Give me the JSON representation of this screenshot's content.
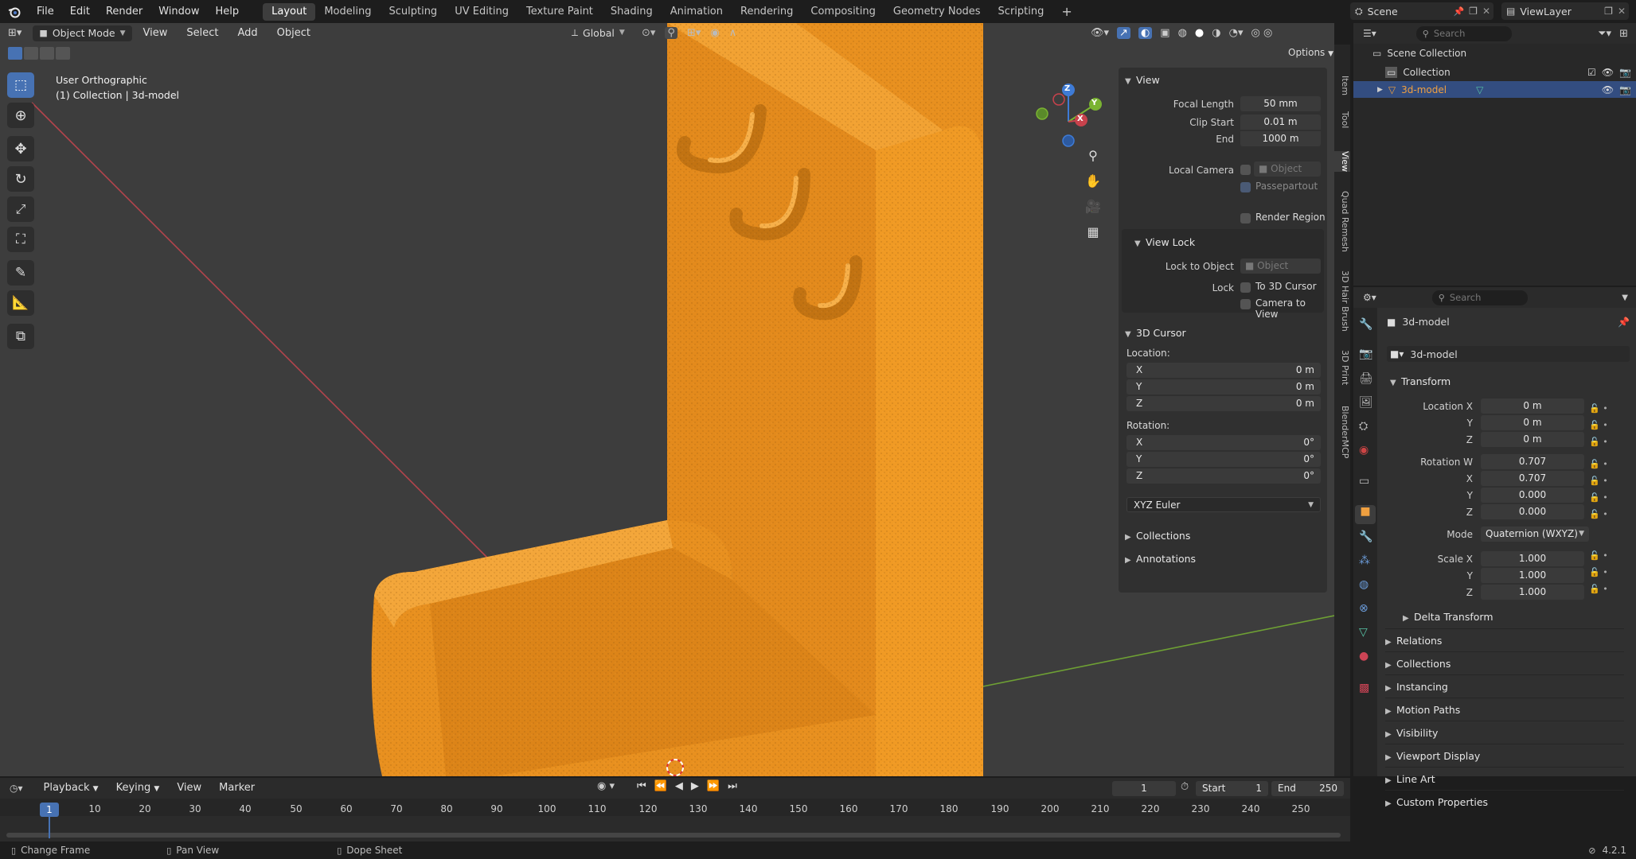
{
  "menu": {
    "items": [
      "File",
      "Edit",
      "Render",
      "Window",
      "Help"
    ]
  },
  "workspaces": {
    "tabs": [
      "Layout",
      "Modeling",
      "Sculpting",
      "UV Editing",
      "Texture Paint",
      "Shading",
      "Animation",
      "Rendering",
      "Compositing",
      "Geometry Nodes",
      "Scripting"
    ],
    "active": "Layout",
    "add": "+"
  },
  "scene": {
    "name": "Scene",
    "view_layer": "ViewLayer"
  },
  "viewport_header": {
    "mode": "Object Mode",
    "menus": [
      "View",
      "Select",
      "Add",
      "Object"
    ],
    "transform_orientation": "Global",
    "options": "Options"
  },
  "viewport": {
    "view_name": "User Orthographic",
    "context": "(1) Collection | 3d-model"
  },
  "gizmo": {
    "x": "X",
    "y": "Y",
    "z": "Z"
  },
  "sidebar_tabs": [
    "Item",
    "Tool",
    "View",
    "Quad Remesh",
    "3D Hair Brush",
    "3D Print",
    "BlenderMCP"
  ],
  "npanel": {
    "view": {
      "title": "View",
      "focal_length_label": "Focal Length",
      "focal_length": "50 mm",
      "clip_start_label": "Clip Start",
      "clip_start": "0.01 m",
      "clip_end_label": "End",
      "clip_end": "1000 m",
      "local_camera_label": "Local Camera",
      "object_placeholder": "Object",
      "passepartout": "Passepartout",
      "render_region": "Render Region"
    },
    "view_lock": {
      "title": "View Lock",
      "lock_to_object_label": "Lock to Object",
      "object_placeholder": "Object",
      "lock_label": "Lock",
      "to_3d_cursor": "To 3D Cursor",
      "camera_to_view": "Camera to View"
    },
    "cursor": {
      "title": "3D Cursor",
      "location_label": "Location:",
      "loc": [
        {
          "axis": "X",
          "value": "0 m"
        },
        {
          "axis": "Y",
          "value": "0 m"
        },
        {
          "axis": "Z",
          "value": "0 m"
        }
      ],
      "rotation_label": "Rotation:",
      "rot": [
        {
          "axis": "X",
          "value": "0°"
        },
        {
          "axis": "Y",
          "value": "0°"
        },
        {
          "axis": "Z",
          "value": "0°"
        }
      ],
      "rotation_mode": "XYZ Euler"
    },
    "collections": "Collections",
    "annotations": "Annotations"
  },
  "outliner": {
    "search_placeholder": "Search",
    "scene_collection": "Scene Collection",
    "collection": "Collection",
    "object": "3d-model"
  },
  "properties": {
    "search_placeholder": "Search",
    "object_name": "3d-model",
    "datablock": "3d-model",
    "transform": {
      "title": "Transform",
      "location_label": "Location X",
      "location": [
        "0 m",
        "0 m",
        "0 m"
      ],
      "rotation_label": "Rotation W",
      "rotation": [
        "0.707",
        "0.707",
        "0.000",
        "0.000"
      ],
      "mode_label": "Mode",
      "mode": "Quaternion (WXYZ)",
      "scale_label": "Scale X",
      "scale": [
        "1.000",
        "1.000",
        "1.000"
      ],
      "axes": {
        "x": "X",
        "y": "Y",
        "z": "Z"
      }
    },
    "delta": "Delta Transform",
    "sections": [
      "Relations",
      "Collections",
      "Instancing",
      "Motion Paths",
      "Visibility",
      "Viewport Display",
      "Line Art",
      "Custom Properties"
    ]
  },
  "timeline": {
    "menus": [
      "Playback",
      "Keying",
      "View",
      "Marker"
    ],
    "current_frame": "1",
    "start_label": "Start",
    "start": "1",
    "end_label": "End",
    "end": "250",
    "ticks": [
      "1",
      "10",
      "20",
      "30",
      "40",
      "50",
      "60",
      "70",
      "80",
      "90",
      "100",
      "110",
      "120",
      "130",
      "140",
      "150",
      "160",
      "170",
      "180",
      "190",
      "200",
      "210",
      "220",
      "230",
      "240",
      "250"
    ]
  },
  "statusbar": {
    "change_frame": "Change Frame",
    "pan_view": "Pan View",
    "dope_sheet": "Dope Sheet",
    "version": "4.2.1"
  },
  "colors": {
    "accent": "#4772b3",
    "model": "#e8901f",
    "x_axis": "#c8424c",
    "y_axis": "#7ab332",
    "z_axis": "#3e7bd6"
  }
}
